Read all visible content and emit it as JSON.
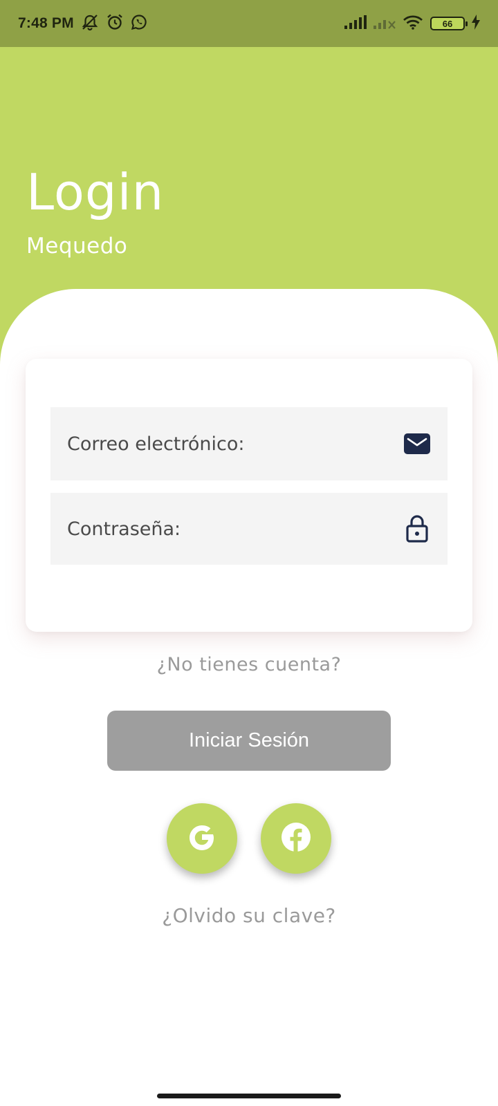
{
  "status_bar": {
    "time": "7:48 PM",
    "battery_level": "66",
    "left_icons": [
      "muted-bell-icon",
      "alarm-icon",
      "whatsapp-icon"
    ],
    "right_icons": [
      "signal-icon",
      "signal-no-sim-icon",
      "wifi-icon",
      "battery-icon",
      "charging-icon"
    ]
  },
  "header": {
    "title": "Login",
    "subtitle": "Mequedo"
  },
  "form": {
    "email_placeholder": "Correo electrónico:",
    "email_value": "",
    "email_icon": "mail-icon",
    "password_placeholder": "Contraseña:",
    "password_value": "",
    "password_icon": "lock-icon"
  },
  "links": {
    "signup": "¿No tienes cuenta?",
    "forgot": "¿Olvido su clave?"
  },
  "login_button": {
    "label": "Iniciar Sesión"
  },
  "social": [
    {
      "name": "google",
      "icon": "google-icon"
    },
    {
      "name": "facebook",
      "icon": "facebook-icon"
    }
  ],
  "colors": {
    "status_bar": "#8fa146",
    "accent_green": "#c0d862",
    "button_gray": "#9e9e9e",
    "field_bg": "#f4f4f4",
    "icon_navy": "#1e2a4a",
    "link_gray": "#9a9a9a"
  }
}
